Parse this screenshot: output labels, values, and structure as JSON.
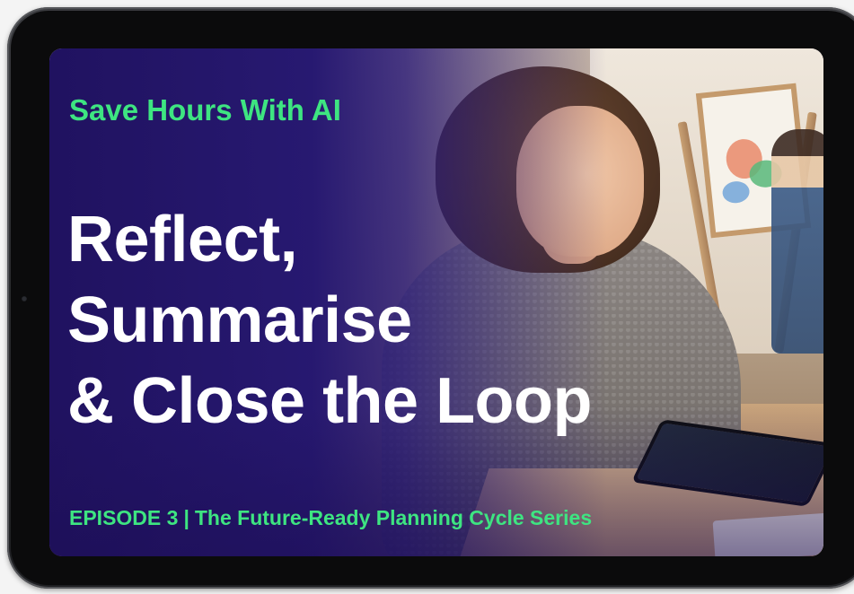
{
  "screen": {
    "kicker": "Save Hours With AI",
    "headline_lines": [
      "Reflect,",
      "Summarise",
      "& Close the Loop"
    ],
    "episode": "EPISODE 3",
    "separator": "|",
    "series": "The Future-Ready Planning Cycle Series"
  },
  "colors": {
    "accent_green": "#3ee581",
    "headline_white": "#ffffff",
    "overlay_purple": "#24166f",
    "tablet_frame": "#2a2b2e"
  }
}
